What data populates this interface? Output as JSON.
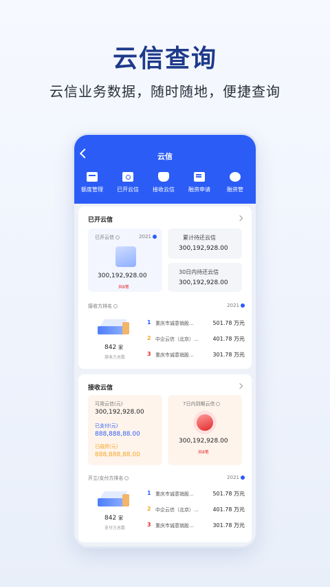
{
  "hero": {
    "title": "云信查询",
    "subtitle": "云信业务数据，随时随地，便捷查询"
  },
  "header": {
    "title": "云信"
  },
  "nav": [
    {
      "label": "额度管理",
      "icon": "wallet-icon"
    },
    {
      "label": "已开云信",
      "icon": "document-icon"
    },
    {
      "label": "接收云信",
      "icon": "receive-icon"
    },
    {
      "label": "融资申请",
      "icon": "form-icon"
    },
    {
      "label": "融资管",
      "icon": "pie-icon"
    }
  ],
  "opened": {
    "title": "已开云信",
    "box1_label": "已开云信",
    "year": "2021",
    "amount": "300,192,928.00",
    "count": "共8笔",
    "total_label": "累计待还云信",
    "total_amount": "300,192,928.00",
    "due_label": "30日内待还云信",
    "due_amount": "300,192,928.00",
    "rank_title": "接收方排名",
    "rank_year": "2021",
    "count_num": "842",
    "count_unit": "家",
    "count_label": "接收方总数",
    "rows": [
      {
        "rank": "1",
        "name": "重庆市诚意销股...",
        "amount": "501.78 万元"
      },
      {
        "rank": "2",
        "name": "中企云信（北京）...",
        "amount": "401.78 万元"
      },
      {
        "rank": "3",
        "name": "重庆市诚意销股...",
        "amount": "301.78 万元"
      }
    ]
  },
  "received": {
    "title": "接收云信",
    "avail_label": "可用云信(元)",
    "avail_amount": "300,192,928.00",
    "paid_label": "已支付(元)",
    "paid_amount": "888,888,88.00",
    "financed_label": "已融资(元)",
    "financed_amount": "888,888,88.00",
    "expire_label": "7日内到期云信",
    "expire_amount": "300,192,928.00",
    "expire_count": "共8笔",
    "rank_title": "开立/支付方排名",
    "rank_year": "2021",
    "count_num": "842",
    "count_unit": "家",
    "count_label": "支付方总数",
    "rows": [
      {
        "rank": "1",
        "name": "重庆市诚意销股...",
        "amount": "501.78 万元"
      },
      {
        "rank": "2",
        "name": "中企云信（北京）...",
        "amount": "401.78 万元"
      },
      {
        "rank": "3",
        "name": "重庆市诚意销股...",
        "amount": "301.78 万元"
      }
    ]
  },
  "colors": {
    "primary": "#2b5cf6",
    "orange": "#f5a623",
    "red": "#e02b2b",
    "title": "#1e3a8a"
  }
}
